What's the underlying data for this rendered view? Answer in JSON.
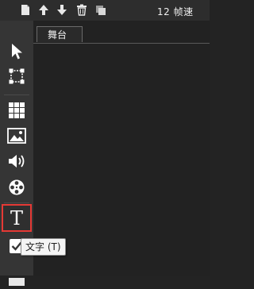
{
  "topbar": {
    "icons": [
      "new-document-icon",
      "move-up-icon",
      "move-down-icon",
      "trash-icon",
      "duplicate-icon"
    ],
    "fps_label": "12 帧速"
  },
  "toolbar": {
    "tools": [
      {
        "name": "select-tool",
        "icon": "arrow-cursor-icon"
      },
      {
        "name": "transform-tool",
        "icon": "bounding-box-icon"
      },
      {
        "name": "grid-tool",
        "icon": "grid-icon"
      },
      {
        "name": "image-tool",
        "icon": "image-icon"
      },
      {
        "name": "audio-tool",
        "icon": "speaker-icon"
      },
      {
        "name": "video-tool",
        "icon": "film-reel-icon"
      },
      {
        "name": "text-tool",
        "icon": "text-icon",
        "glyph": "T",
        "selected": true
      },
      {
        "name": "checkbox-tool",
        "icon": "checkbox-icon"
      },
      {
        "name": "rect-tool",
        "icon": "rectangle-icon"
      }
    ]
  },
  "stage": {
    "tab_label": "舞台"
  },
  "tooltip": {
    "text": "文字 (T)"
  },
  "colors": {
    "selection_outline": "#e53935",
    "background": "#232323",
    "toolbar": "#353535"
  }
}
